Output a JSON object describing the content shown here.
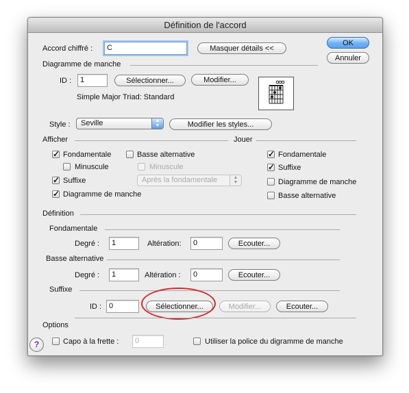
{
  "window": {
    "title": "Définition de l'accord"
  },
  "chord": {
    "label": "Accord chiffré :",
    "value": "C",
    "details_button": "Masquer détails <<"
  },
  "buttons": {
    "ok": "OK",
    "cancel": "Annuler"
  },
  "diagram": {
    "section": "Diagramme de manche",
    "id_label": "ID :",
    "id_value": "1",
    "select_button": "Sélectionner...",
    "modify_button": "Modifier...",
    "description": "Simple Major Triad:  Standard"
  },
  "style": {
    "label": "Style :",
    "value": "Seville",
    "modify_button": "Modifier les styles..."
  },
  "display": {
    "section": "Afficher",
    "fondamentale": "Fondamentale",
    "minuscule": "Minuscule",
    "suffixe": "Suffixe",
    "diagramme": "Diagramme de manche",
    "basse_alt": "Basse alternative",
    "minuscule2": "Minuscule",
    "position_popup": "Aprés la fondamentale"
  },
  "play": {
    "section": "Jouer",
    "fondamentale": "Fondamentale",
    "suffixe": "Suffixe",
    "diagramme": "Diagramme de manche",
    "basse_alt": "Basse alternative"
  },
  "definition": {
    "section": "Définition",
    "root": {
      "section": "Fondamentale",
      "degree_label": "Degré :",
      "degree": "1",
      "alter_label": "Altération:",
      "alter": "0",
      "listen": "Ecouter..."
    },
    "bass": {
      "section": "Basse alternative",
      "degree_label": "Degré :",
      "degree": "1",
      "alter_label": "Altération :",
      "alter": "0",
      "listen": "Ecouter..."
    },
    "suffix": {
      "section": "Suffixe",
      "id_label": "ID :",
      "id": "0",
      "select": "Sélectionner...",
      "modify": "Modifier...",
      "listen": "Ecouter..."
    }
  },
  "options": {
    "section": "Options",
    "capo_label": "Capo à la frette :",
    "capo_value": "0",
    "use_font": "Utiliser la police du digramme de manche"
  },
  "help": {
    "symbol": "?"
  }
}
